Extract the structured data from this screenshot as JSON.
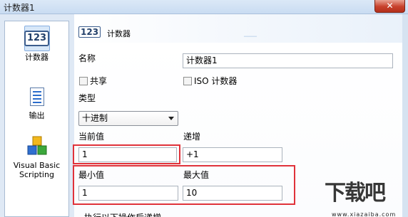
{
  "window": {
    "title": "计数器1",
    "close_label": "✕"
  },
  "sidebar": {
    "items": [
      {
        "label": "计数器",
        "icon_text": "123",
        "icon": "counter-icon",
        "selected": true
      },
      {
        "label": "输出",
        "icon": "output-document-icon"
      },
      {
        "label": "Visual Basic Scripting",
        "icon": "vbscript-blocks-icon"
      }
    ]
  },
  "header": {
    "icon_text": "123",
    "title": "计数器"
  },
  "form": {
    "name_label": "名称",
    "name_value": "计数器1",
    "shared_label": "共享",
    "iso_label": "ISO 计数器",
    "type_label": "类型",
    "type_value": "十进制",
    "current_label": "当前值",
    "current_value": "1",
    "increment_label": "递增",
    "increment_value": "+1",
    "min_label": "最小值",
    "min_value": "1",
    "max_label": "最大值",
    "max_value": "10",
    "after_label": "执行以下操作后递增"
  },
  "watermark": {
    "brand": "下载吧",
    "url": "www.xiazaiba.com"
  },
  "colors": {
    "highlight_box": "#e0323a",
    "selection": "#d7e7f8",
    "titlebar": "#c9dcf2"
  }
}
